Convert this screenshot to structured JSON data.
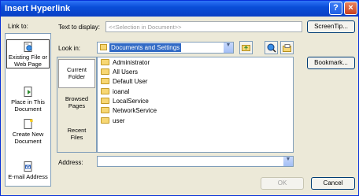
{
  "window": {
    "title": "Insert Hyperlink",
    "help_glyph": "?",
    "close_glyph": "×"
  },
  "link_to": {
    "label": "Link to:",
    "items": [
      {
        "line1": "Existing File or",
        "line2": "Web Page",
        "icon": "web-page-icon",
        "selected": true
      },
      {
        "line1": "Place in This",
        "line2": "Document",
        "icon": "document-place-icon"
      },
      {
        "line1": "Create New",
        "line2": "Document",
        "icon": "new-document-icon"
      },
      {
        "line1": "E-mail Address",
        "line2": "",
        "icon": "email-icon"
      }
    ]
  },
  "text_to_display": {
    "label": "Text to display:",
    "value": "<<Selection in Document>>"
  },
  "screentip_button": "ScreenTip...",
  "look_in": {
    "label": "Look in:",
    "value": "Documents and Settings"
  },
  "bookmark_button": "Bookmark...",
  "places": [
    {
      "line1": "Current",
      "line2": "Folder",
      "selected": true
    },
    {
      "line1": "Browsed",
      "line2": "Pages"
    },
    {
      "line1": "Recent",
      "line2": "Files"
    }
  ],
  "files": [
    "Administrator",
    "All Users",
    "Default User",
    "ioanal",
    "LocalService",
    "NetworkService",
    "user"
  ],
  "address": {
    "label": "Address:",
    "value": ""
  },
  "ok_button": "OK",
  "cancel_button": "Cancel"
}
